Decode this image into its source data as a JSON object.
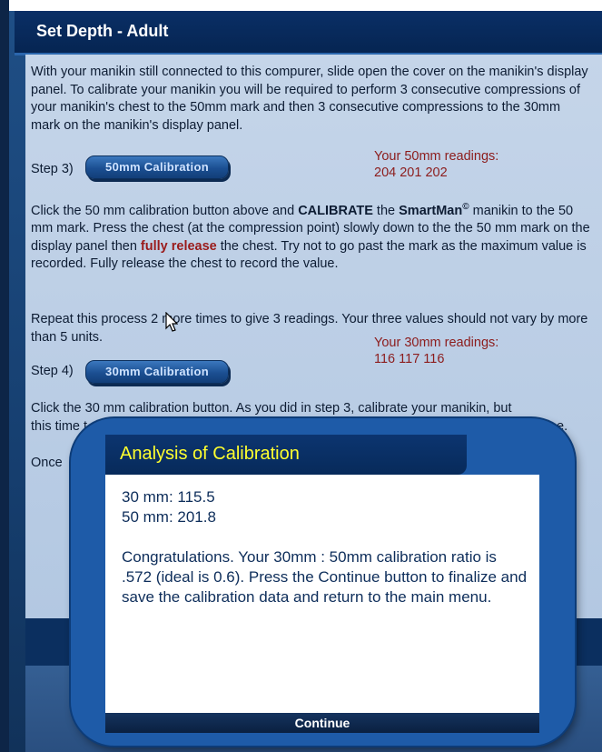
{
  "header": {
    "title": "Set Depth - Adult"
  },
  "intro": {
    "text": "With your manikin still connected to this compurer, slide open the cover on the manikin's display panel. To calibrate your manikin you will be required to perform 3 consecutive compressions of your manikin's chest to the 50mm mark and then 3 consecutive compressions to the 30mm mark on the manikin's display panel."
  },
  "step3": {
    "label": "Step 3)",
    "button": "50mm Calibration",
    "readings_title": "Your 50mm readings:",
    "readings_values": "204 201 202"
  },
  "instructions50": {
    "part1": "Click the 50 mm calibration button above and ",
    "calibrate": "CALIBRATE",
    "part2": " the ",
    "brand": "SmartMan",
    "brand_mark": "©",
    "part3": " manikin to the 50 mm mark. Press the chest (at the compression point) slowly down to the the 50 mm mark on the display panel then ",
    "fully_release": "fully release",
    "part4": " the chest. Try not to go past the mark as the maximum value is recorded. Fully release the chest to record the value."
  },
  "repeat": {
    "text": "Repeat this process 2 more times to give 3 readings. Your three values should not vary by more than 5 units."
  },
  "step4": {
    "label": "Step 4)",
    "button": "30mm Calibration",
    "readings_title": "Your 30mm readings:",
    "readings_values": "116 117 116"
  },
  "instructions30": {
    "line1": "Click the 30 mm calibration button. As you did in step 3, calibrate your manikin, but",
    "line2_start": "this time t",
    "line2_end": "e.",
    "once": "Once"
  },
  "dialog": {
    "title": "Analysis of Calibration",
    "result30": "30 mm: 115.5",
    "result50": "50 mm: 201.8",
    "message": "Congratulations. Your 30mm : 50mm calibration ratio is .572 (ideal is 0.6). Press the Continue button to finalize and save the calibration data and return to the main menu.",
    "continue_label": "Continue"
  },
  "colors": {
    "header_bg": "#0a2f66",
    "panel_bg": "#c5d5e9",
    "dialog_title": "#ffff2e",
    "reading_text": "#8c1c1c"
  },
  "icons": {
    "cursor": "arrow-cursor-icon"
  }
}
